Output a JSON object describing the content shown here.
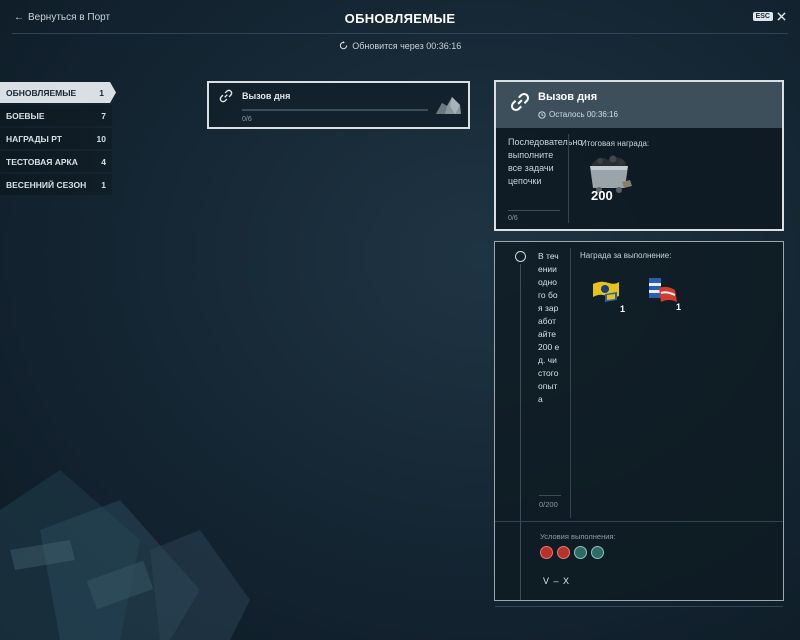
{
  "header": {
    "back_label": "Вернуться в Порт",
    "title": "ОБНОВЛЯЕМЫЕ",
    "esc_key": "ESC",
    "refresh_text": "Обновится через 00:36:16"
  },
  "sidebar": {
    "items": [
      {
        "label": "ОБНОВЛЯЕМЫЕ",
        "count": "1",
        "active": true
      },
      {
        "label": "БОЕВЫЕ",
        "count": "7"
      },
      {
        "label": "НАГРАДЫ РТ",
        "count": "10"
      },
      {
        "label": "ТЕСТОВАЯ АРКА",
        "count": "4"
      },
      {
        "label": "ВЕСЕННИЙ СЕЗОН",
        "count": "1"
      }
    ]
  },
  "challenge_card": {
    "title": "Вызов дня",
    "progress": "0/6",
    "progress_fraction": 0
  },
  "detail": {
    "title": "Вызов дня",
    "time_left": "Осталось 00:36:16",
    "description": "Последовательно выполните все задачи цепочки",
    "progress": "0/6",
    "final_reward_label": "Итоговая награда:",
    "final_reward_amount": "200",
    "final_reward_icon": "coal-cart-icon"
  },
  "task": {
    "text": "В течении одного боя заработайте 200 ед. чистого опыта",
    "progress": "0/200",
    "reward_label": "Награда за выполнение:",
    "rewards": [
      {
        "icon": "signal-flag-yellow-icon",
        "count": "1"
      },
      {
        "icon": "signal-flag-blue-red-icon",
        "count": "1"
      }
    ],
    "conditions_label": "Условия выполнения:",
    "condition_icons": [
      "battleship-icon",
      "cruiser-icon",
      "destroyer-icon",
      "aircraft-carrier-icon"
    ],
    "tiers": "V – X"
  },
  "colors": {
    "accent_panel": "#3d4f5b",
    "active_tab": "#d9dfe3",
    "background": "#142532"
  }
}
